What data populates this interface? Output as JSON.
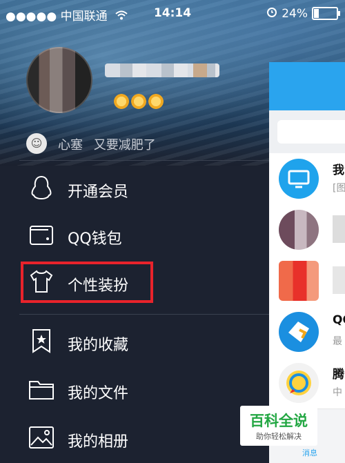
{
  "status_bar": {
    "carrier": "●●●●● 中国联通",
    "wifi_icon": "wifi-icon",
    "time": "14:14",
    "alarm_icon": "alarm-icon",
    "battery_text": "24%",
    "battery_level_percent": 24
  },
  "profile": {
    "nickname": "",
    "level_icons": [
      "sun-icon",
      "sun-icon",
      "sun-icon"
    ],
    "signature_name": "心塞",
    "signature_text": "又要减肥了"
  },
  "menu": {
    "items": [
      {
        "label": "开通会员",
        "icon": "penguin-icon"
      },
      {
        "label": "QQ钱包",
        "icon": "wallet-icon"
      },
      {
        "label": "个性装扮",
        "icon": "tshirt-icon",
        "highlighted": true
      },
      {
        "label": "我的收藏",
        "icon": "bookmark-star-icon"
      },
      {
        "label": "我的文件",
        "icon": "folder-icon"
      },
      {
        "label": "我的相册",
        "icon": "photo-icon"
      }
    ]
  },
  "right_panel": {
    "chats": [
      {
        "title": "我",
        "subtitle": "[图"
      },
      {
        "title": "",
        "subtitle": ""
      },
      {
        "title": "",
        "subtitle": ""
      },
      {
        "title": "QQ",
        "subtitle": "最"
      },
      {
        "title": "腾",
        "subtitle": "中"
      }
    ],
    "bottom_tab": "消息"
  },
  "watermark": {
    "title": "百科全说",
    "subtitle": "助你轻松解决"
  },
  "colors": {
    "highlight": "#e8232b",
    "qq_blue": "#2aa4ee",
    "sidebar_bg": "#1c2230"
  }
}
